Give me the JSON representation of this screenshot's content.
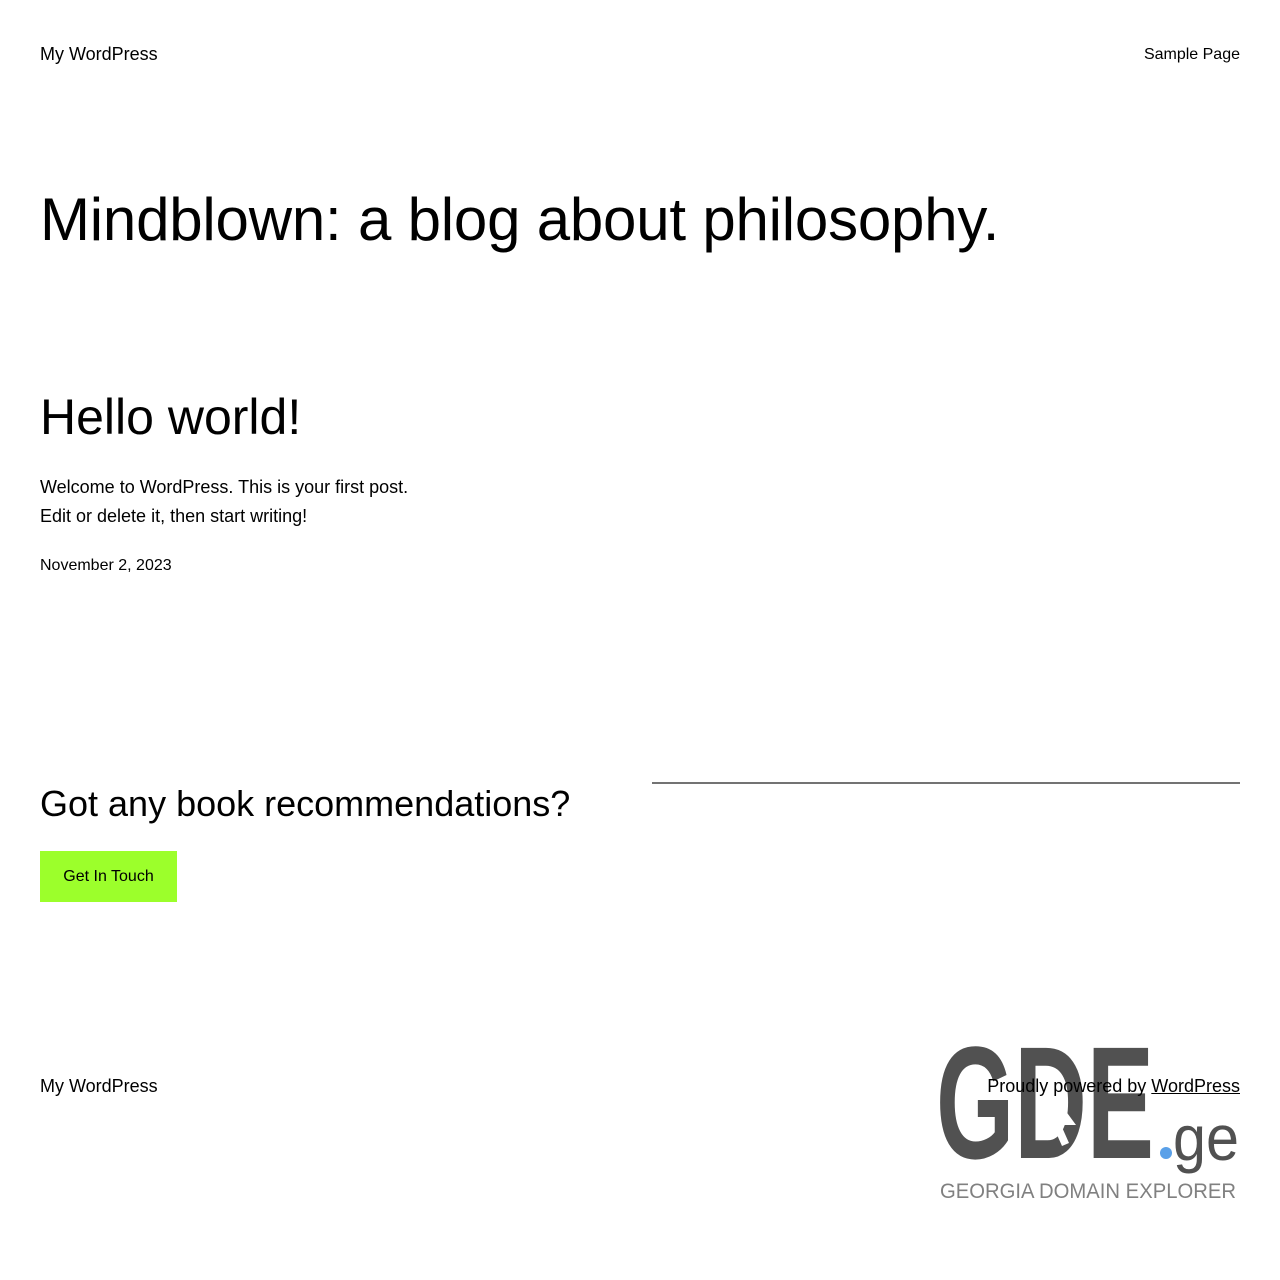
{
  "header": {
    "site_title": "My WordPress",
    "nav_link": "Sample Page"
  },
  "hero": {
    "heading": "Mindblown: a blog about philosophy."
  },
  "post": {
    "title": "Hello world!",
    "excerpt_line1": "Welcome to WordPress. This is your first post.",
    "excerpt_line2": "Edit or delete it, then start writing!",
    "date": "November 2, 2023"
  },
  "cta": {
    "heading": "Got any book recommendations?",
    "button_label": "Get In Touch",
    "button_color": "#9cff2b"
  },
  "footer": {
    "site_title": "My WordPress",
    "credits_prefix": "Proudly powered by",
    "credits_link": "WordPress"
  },
  "watermark": {
    "logo_text": "GDE",
    "logo_suffix": ".ge",
    "tagline": "GEORGIA DOMAIN EXPLORER",
    "text_color": "#515151",
    "dot_color": "#5aa0e8",
    "tagline_color": "#808080"
  }
}
